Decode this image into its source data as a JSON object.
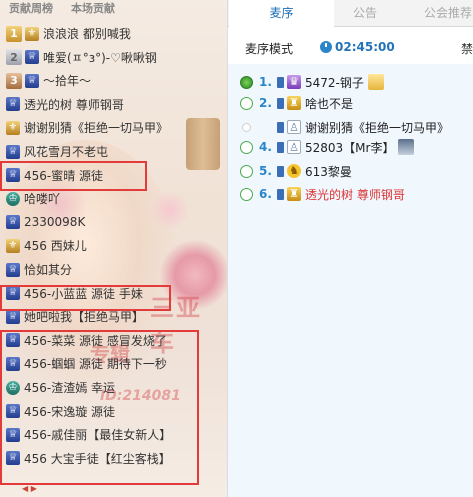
{
  "left_panel": {
    "tabs": [
      "贡献周榜",
      "本场贡献"
    ],
    "watermarks": [
      "三亚车",
      "专辑",
      "ID:214081"
    ],
    "scroll_glyph": "慧\n雅",
    "rows": [
      {
        "name": "浪浪浪 都别喊我",
        "badge": "gold",
        "badge_text": "1",
        "icon": "gold"
      },
      {
        "name": "唯爱(ㅍ°з°)-♡啾啾钢",
        "badge": "silver",
        "badge_text": "2",
        "icon": "blue"
      },
      {
        "name": "～拾年～",
        "badge": "bronze",
        "badge_text": "3",
        "icon": "blue"
      },
      {
        "name": "透光的树 尊师钢哥",
        "badge": "",
        "icon": "blue"
      },
      {
        "name": "谢谢别猜《拒绝一切马甲》",
        "badge": "",
        "icon": "gold"
      },
      {
        "name": "风花雪月不老屯",
        "badge": "",
        "icon": "blue"
      },
      {
        "name": "456-蜜晴 源徒",
        "badge": "",
        "icon": "blue"
      },
      {
        "name": "哈喽吖",
        "badge": "",
        "icon": "teal"
      },
      {
        "name": "2330098K",
        "badge": "",
        "icon": "blue"
      },
      {
        "name": "456 西妹儿",
        "badge": "",
        "icon": "gold"
      },
      {
        "name": "恰如其分",
        "badge": "",
        "icon": "blue"
      },
      {
        "name": "456-小蓝蓝 源徒 手妹",
        "badge": "",
        "icon": "blue"
      },
      {
        "name": "她吧啦我【拒绝马甲】",
        "badge": "",
        "icon": "blue"
      },
      {
        "name": "456-菜菜 源徒 感冒发烧了",
        "badge": "",
        "icon": "blue"
      },
      {
        "name": "456-蝈蝈 源徒 期待下一秒",
        "badge": "",
        "icon": "blue"
      },
      {
        "name": "456-渣渣嫣 幸运",
        "badge": "",
        "icon": "teal"
      },
      {
        "name": "456-宋逸璇 源徒",
        "badge": "",
        "icon": "blue"
      },
      {
        "name": "456-戚佳丽【最佳女新人】",
        "badge": "",
        "icon": "blue"
      },
      {
        "name": "456 大宝手徒【红尘客栈】",
        "badge": "",
        "icon": "blue"
      }
    ]
  },
  "right_panel": {
    "tabs": {
      "sequence": "麦序",
      "notice": "公告",
      "guild": "公会推荐"
    },
    "mode_label": "麦序模式",
    "clock": "02:45:00",
    "ban_label": "禁",
    "queue": [
      {
        "num": "1.",
        "name": "5472-钢子",
        "mic": "on",
        "role_icon": "purple",
        "tag": "star"
      },
      {
        "num": "2.",
        "name": "啥也不是",
        "mic": "idle",
        "role_icon": "gold",
        "tag": ""
      },
      {
        "num": "",
        "name": "谢谢别猜《拒绝一切马甲》",
        "mic": "off",
        "role_icon": "gray",
        "tag": ""
      },
      {
        "num": "4.",
        "name": "52803【Mr李】",
        "mic": "idle",
        "role_icon": "gray",
        "tag": "avatar"
      },
      {
        "num": "5.",
        "name": "613黎曼",
        "mic": "idle",
        "role_icon": "yellow",
        "tag": ""
      },
      {
        "num": "6.",
        "name": "透光的树 尊师钢哥",
        "mic": "idle",
        "role_icon": "gold",
        "tag": ""
      }
    ]
  },
  "colors": {
    "highlight": "#e33a3a",
    "active_tab": "#1d6fb5",
    "queue_bg": "#f0f8fe"
  }
}
